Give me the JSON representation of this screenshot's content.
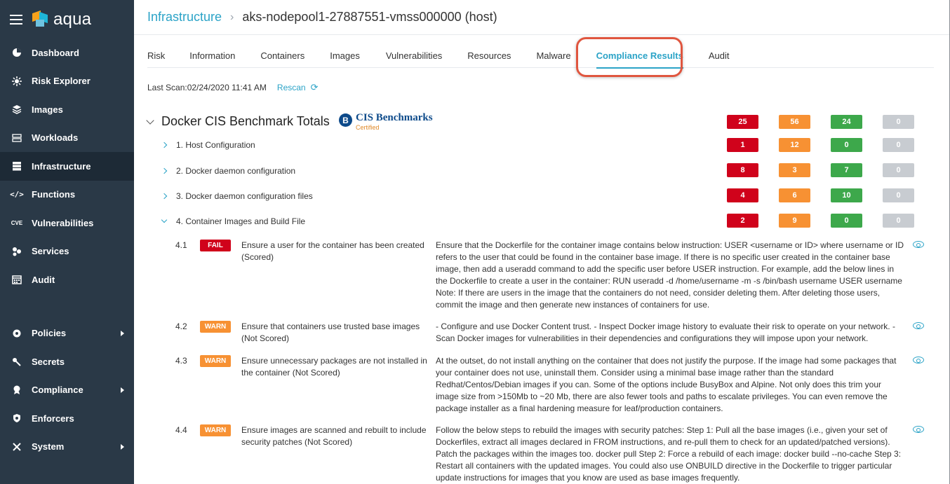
{
  "sidebar": {
    "logo": "aqua",
    "items": [
      {
        "label": "Dashboard",
        "icon": "dashboard-icon"
      },
      {
        "label": "Risk Explorer",
        "icon": "risk-explorer-icon"
      },
      {
        "label": "Images",
        "icon": "images-icon"
      },
      {
        "label": "Workloads",
        "icon": "workloads-icon"
      },
      {
        "label": "Infrastructure",
        "icon": "infrastructure-icon"
      },
      {
        "label": "Functions",
        "icon": "functions-icon"
      },
      {
        "label": "Vulnerabilities",
        "icon": "vulnerabilities-icon"
      },
      {
        "label": "Services",
        "icon": "services-icon"
      },
      {
        "label": "Audit",
        "icon": "audit-icon"
      },
      {
        "label": "Policies",
        "icon": "policies-icon"
      },
      {
        "label": "Secrets",
        "icon": "secrets-icon"
      },
      {
        "label": "Compliance",
        "icon": "compliance-icon"
      },
      {
        "label": "Enforcers",
        "icon": "enforcers-icon"
      },
      {
        "label": "System",
        "icon": "system-icon"
      }
    ],
    "cve_icon_text": "CVE"
  },
  "header": {
    "breadcrumb_root": "Infrastructure",
    "breadcrumb_current": "aks-nodepool1-27887551-vmss000000 (host)"
  },
  "tabs": [
    "Risk",
    "Information",
    "Containers",
    "Images",
    "Vulnerabilities",
    "Resources",
    "Malware",
    "Compliance Results",
    "Audit"
  ],
  "active_tab": "Compliance Results",
  "scan": {
    "last_scan": "Last Scan:02/24/2020 11:41 AM",
    "rescan_label": "Rescan"
  },
  "benchmark": {
    "title": "Docker CIS Benchmark Totals",
    "logo_text": "CIS Benchmarks",
    "logo_sub": "Certified",
    "logo_badge": "B",
    "totals": [
      "25",
      "56",
      "24",
      "0"
    ],
    "sections": [
      {
        "label": "1. Host Configuration",
        "counts": [
          "1",
          "12",
          "0",
          "0"
        ]
      },
      {
        "label": "2. Docker daemon configuration",
        "counts": [
          "8",
          "3",
          "7",
          "0"
        ]
      },
      {
        "label": "3. Docker daemon configuration files",
        "counts": [
          "4",
          "6",
          "10",
          "0"
        ]
      },
      {
        "label": "4. Container Images and Build File",
        "counts": [
          "2",
          "9",
          "0",
          "0"
        ]
      }
    ],
    "rules": [
      {
        "id": "4.1",
        "status": "FAIL",
        "title": "Ensure a user for the container has been created (Scored)",
        "desc": "Ensure that the Dockerfile for the container image contains below instruction: USER <username or ID> where username or ID refers to the user that could be found in the container base image. If there is no specific user created in the container base image, then add a useradd command to add the specific user before USER instruction. For example, add the below lines in the Dockerfile to create a user in the container: RUN useradd -d /home/username -m -s /bin/bash username USER username Note: If there are users in the image that the containers do not need, consider deleting them. After deleting those users, commit the image and then generate new instances of containers for use."
      },
      {
        "id": "4.2",
        "status": "WARN",
        "title": "Ensure that containers use trusted base images (Not Scored)",
        "desc": "- Configure and use Docker Content trust. - Inspect Docker image history to evaluate their risk to operate on your network. - Scan Docker images for vulnerabilities in their dependencies and configurations they will impose upon your network."
      },
      {
        "id": "4.3",
        "status": "WARN",
        "title": "Ensure unnecessary packages are not installed in the container (Not Scored)",
        "desc": "At the outset, do not install anything on the container that does not justify the purpose. If the image had some packages that your container does not use, uninstall them. Consider using a minimal base image rather than the standard Redhat/Centos/Debian images if you can. Some of the options include BusyBox and Alpine. Not only does this trim your image size from >150Mb to ~20 Mb, there are also fewer tools and paths to escalate privileges. You can even remove the package installer as a final hardening measure for leaf/production containers."
      },
      {
        "id": "4.4",
        "status": "WARN",
        "title": "Ensure images are scanned and rebuilt to include security patches (Not Scored)",
        "desc": "Follow the below steps to rebuild the images with security patches: Step 1: Pull all the base images (i.e., given your set of Dockerfiles, extract all images declared in FROM instructions, and re-pull them to check for an updated/patched versions). Patch the packages within the images too. docker pull Step 2: Force a rebuild of each image: docker build --no-cache Step 3: Restart all containers with the updated images. You could also use ONBUILD directive in the Dockerfile to trigger particular update instructions for images that you know are used as base images frequently."
      }
    ]
  },
  "colors": {
    "sidebar_bg": "#2a3947",
    "accent": "#2ba3c7",
    "fail": "#d0021b",
    "warn": "#f79133",
    "pass": "#3da84b",
    "na": "#c8ccd1",
    "highlight": "#e0563f"
  }
}
